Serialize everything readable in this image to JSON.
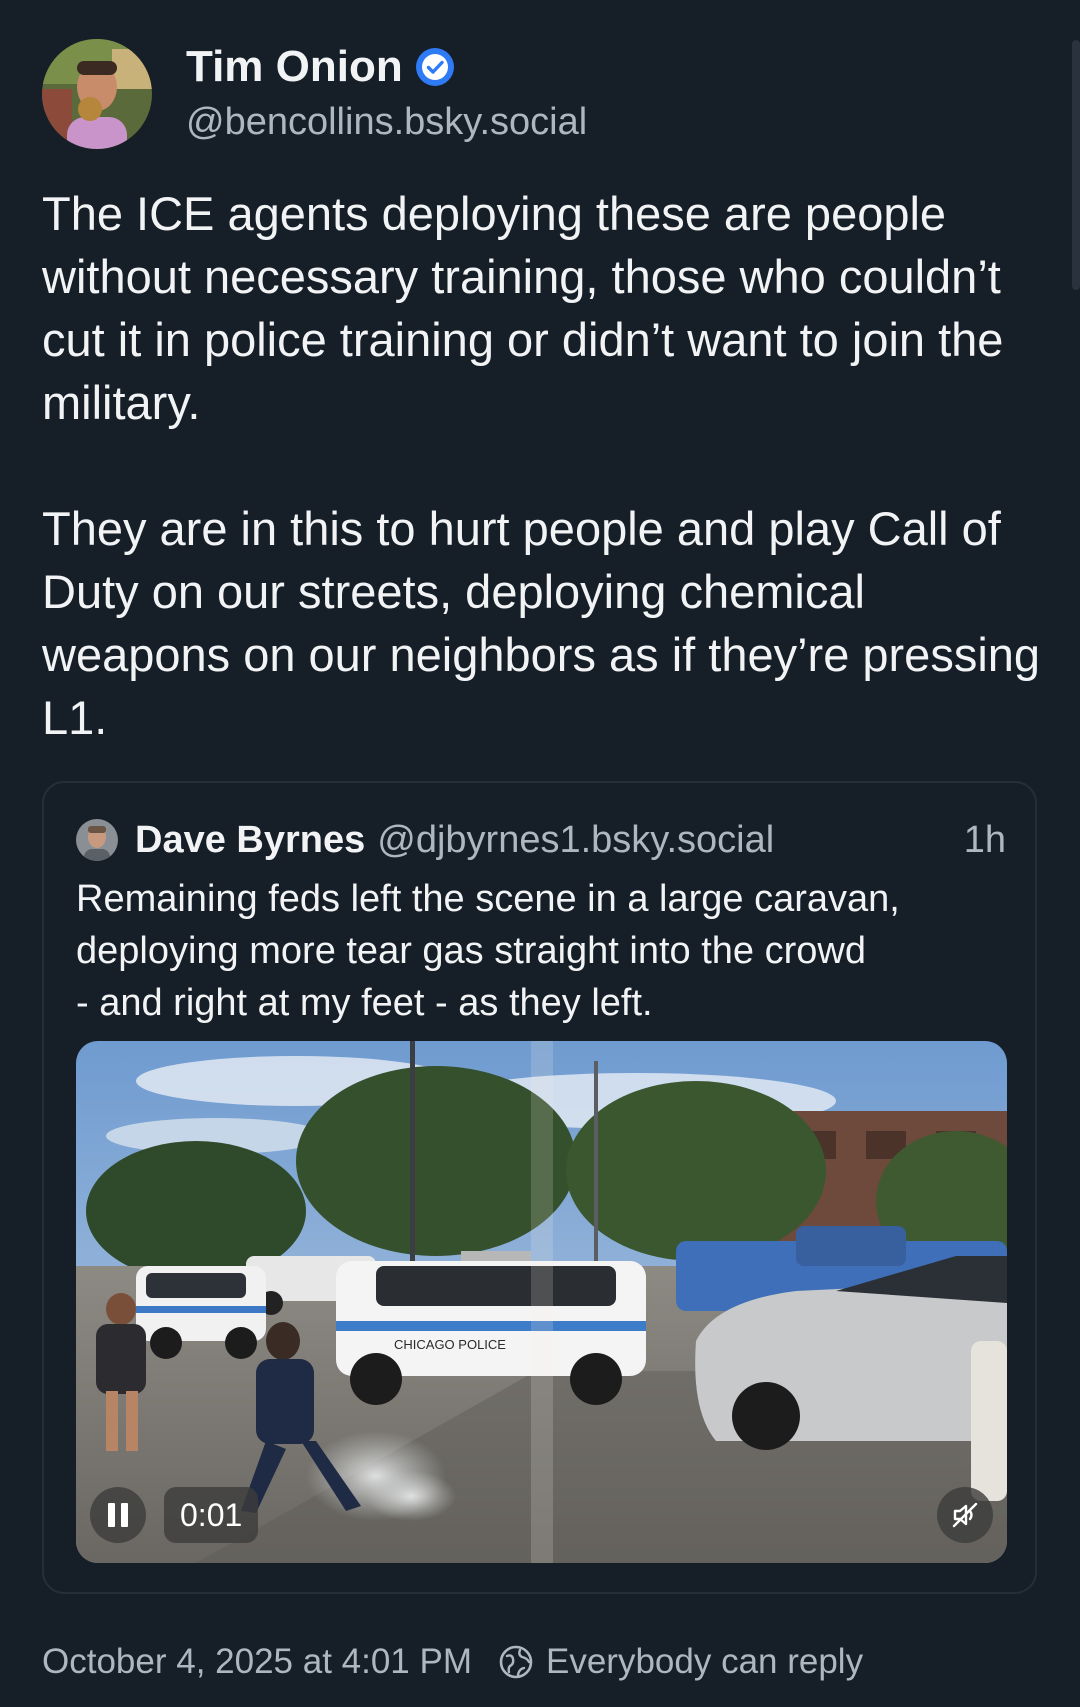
{
  "post": {
    "author": {
      "display_name": "Tim Onion",
      "handle": "@bencollins.bsky.social",
      "verified": true
    },
    "text": {
      "paragraph_1": "The ICE agents deploying these are people without necessary training, those who couldn’t cut it in police training or didn’t want to join the military.",
      "paragraph_2": "They are in this to hurt people and play Call of Duty on our streets, deploying chemical weapons on our neighbors as if they’re pressing L1."
    },
    "quote": {
      "author": {
        "display_name": "Dave Byrnes",
        "handle": "@djbyrnes1.bsky.social"
      },
      "time": "1h",
      "text_lines": [
        "Remaining feds left the scene in a large caravan,",
        "deploying more tear gas straight into the crowd",
        "- and right at my feet - as they left."
      ],
      "video": {
        "timecode": "0:01",
        "vehicle_lettering": "CHICAGO  POLICE",
        "playing": true,
        "muted": true
      }
    },
    "footer": {
      "timestamp": "October 4, 2025 at 4:01 PM",
      "reply_setting": "Everybody can reply"
    }
  },
  "colors": {
    "background": "#161e27",
    "text_primary": "#f1f3f5",
    "text_secondary": "#aeb6c0",
    "verified_badge": "#2f7bf5",
    "card_border": "#262f39"
  },
  "icons": {
    "verified": "verified-badge-icon",
    "pause": "pause-icon",
    "mute": "speaker-muted-icon",
    "reply_setting": "globe-icon"
  }
}
